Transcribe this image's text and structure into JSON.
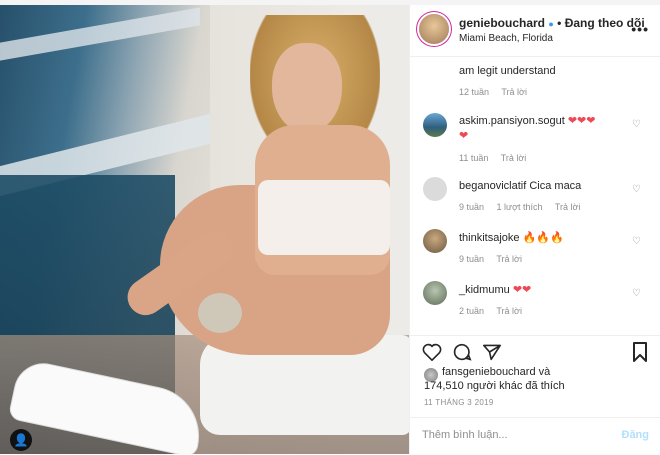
{
  "post": {
    "username": "geniebouchard",
    "verified_icon": "verified-badge-icon",
    "separator": "•",
    "follow_status": "Đang theo dõi",
    "location": "Miami Beach, Florida",
    "more": "•••"
  },
  "comments": [
    {
      "user": "",
      "text": "am legit understand",
      "time": "12 tuần",
      "likes": "",
      "reply": "Trả lời",
      "emoji": ""
    },
    {
      "user": "askim.pansiyon.sogut",
      "text": "",
      "emoji": "❤❤❤",
      "emoji2": "❤",
      "time": "11 tuần",
      "likes": "",
      "reply": "Trả lời"
    },
    {
      "user": "beganoviclatif",
      "text": "Cica maca",
      "emoji": "",
      "time": "9 tuần",
      "likes": "1 lượt thích",
      "reply": "Trả lời"
    },
    {
      "user": "thinkitsajoke",
      "text": "",
      "emoji": "🔥🔥🔥",
      "time": "9 tuần",
      "likes": "",
      "reply": "Trả lời"
    },
    {
      "user": "_kidmumu",
      "text": "",
      "emoji": "❤❤",
      "time": "2 tuần",
      "likes": "",
      "reply": "Trả lời"
    }
  ],
  "likes": {
    "user": "fansgeniebouchard",
    "and": "và",
    "others": "174,510 người khác đã thích"
  },
  "date": "11 THÁNG 3 2019",
  "comment_box": {
    "placeholder": "Thêm bình luận...",
    "post_label": "Đăng"
  },
  "colors": {
    "accent": "#3897f0",
    "heart": "#ed4956",
    "muted": "#8e8e8e"
  }
}
